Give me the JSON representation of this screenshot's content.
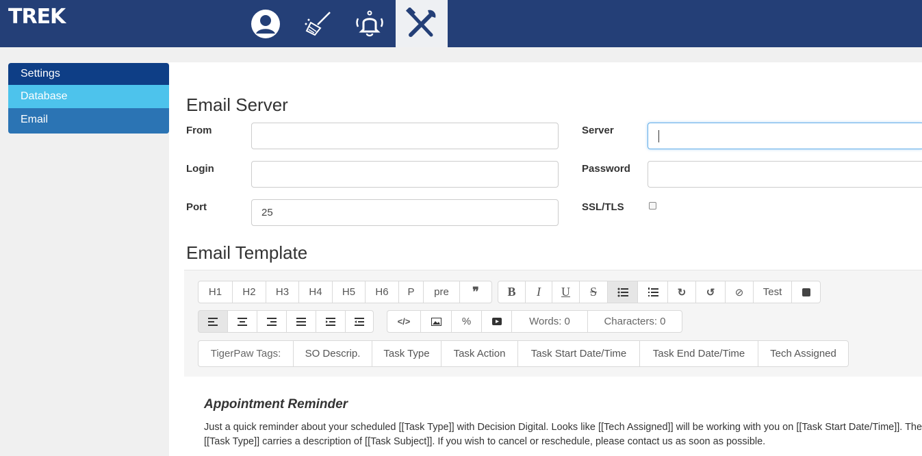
{
  "app": {
    "logo_text": "TREK"
  },
  "nav": {
    "icons": [
      {
        "name": "user-icon",
        "active": false
      },
      {
        "name": "broom-icon",
        "active": false
      },
      {
        "name": "bell-icon",
        "active": false
      },
      {
        "name": "tools-icon",
        "active": true
      }
    ]
  },
  "sidebar": {
    "items": [
      {
        "label": "Settings"
      },
      {
        "label": "Database"
      },
      {
        "label": "Email"
      }
    ]
  },
  "email_server": {
    "heading": "Email Server",
    "from_label": "From",
    "from_value": "",
    "login_label": "Login",
    "login_value": "",
    "port_label": "Port",
    "port_value": "25",
    "server_label": "Server",
    "server_value": "",
    "password_label": "Password",
    "password_value": "",
    "ssl_label": "SSL/TLS",
    "ssl_checked": false
  },
  "email_template": {
    "heading": "Email Template",
    "toolbar_row1_headings": [
      "H1",
      "H2",
      "H3",
      "H4",
      "H5",
      "H6",
      "P",
      "pre"
    ],
    "toolbar_row1_format": [
      "B",
      "I",
      "U",
      "S"
    ],
    "test_label": "Test",
    "words_label": "Words: 0",
    "chars_label": "Characters: 0",
    "tags": [
      "TigerPaw Tags:",
      "SO Descrip.",
      "Task Type",
      "Task Action",
      "Task Start Date/Time",
      "Task End Date/Time",
      "Tech Assigned"
    ],
    "content_title": "Appointment Reminder",
    "content_body": "Just a quick reminder about your scheduled [[Task Type]] with Decision Digital. Looks like [[Tech Assigned]] will be working with you on [[Task Start Date/Time]]. The [[Task Type]] carries a description of [[Task Subject]]. If you wish to cancel or reschedule, please contact us as soon as possible."
  },
  "colors": {
    "topbar": "#243f77",
    "sidebar_settings": "#0e3e86",
    "sidebar_database": "#4dc3ec",
    "sidebar_email": "#2b74b4"
  }
}
